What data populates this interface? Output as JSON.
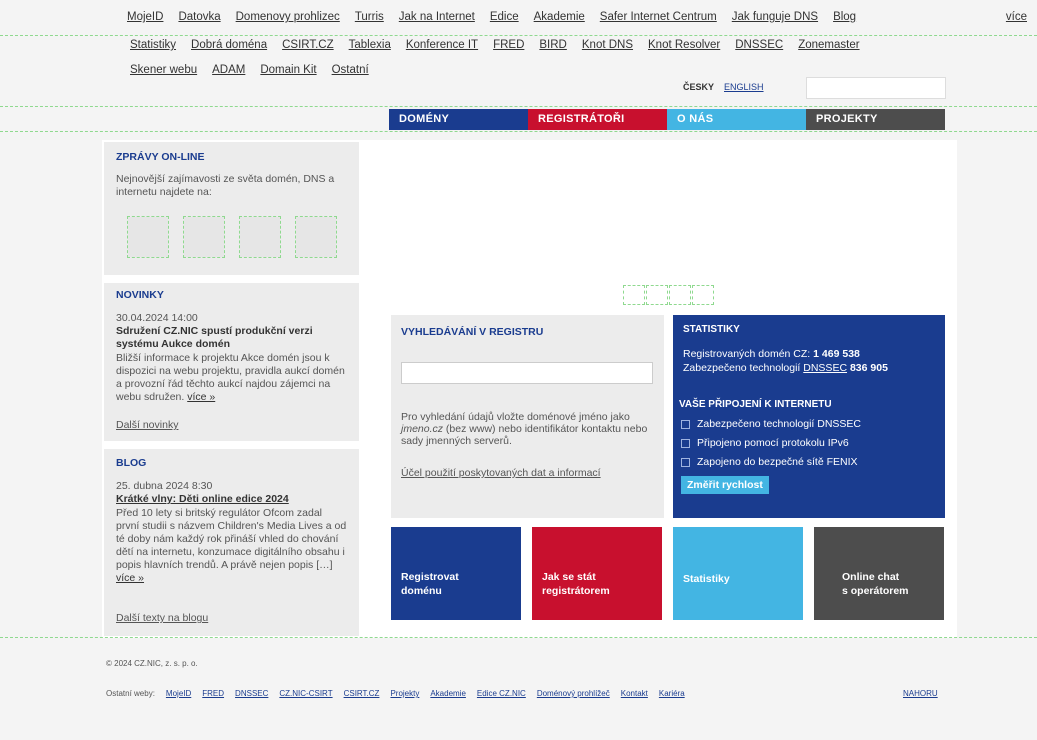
{
  "topnav": {
    "row1": [
      "MojeID",
      "Datovka",
      "Domenovy prohlizec",
      "Turris",
      "Jak na Internet",
      "Edice",
      "Akademie",
      "Safer Internet Centrum",
      "Jak funguje DNS",
      "Blog"
    ],
    "row2": [
      "Statistiky",
      "Dobrá doména",
      "CSIRT.CZ",
      "Tablexia",
      "Konference IT",
      "FRED",
      "BIRD",
      "Knot DNS",
      "Knot Resolver",
      "DNSSEC",
      "Zonemaster"
    ],
    "row3": [
      "Skener webu",
      "ADAM",
      "Domain Kit",
      "Ostatní"
    ],
    "more": "více"
  },
  "lang": {
    "cs": "ČESKY",
    "en": "ENGLISH"
  },
  "mainnav": [
    "DOMÉNY",
    "REGISTRÁTOŘI",
    "O NÁS",
    "PROJEKTY"
  ],
  "colors": {
    "blue": "#1a3c8f",
    "red": "#c8102e",
    "lightblue": "#43b5e3",
    "gray": "#4d4d4d"
  },
  "news_online": {
    "heading": "ZPRÁVY ON-LINE",
    "text": "Nejnovější zajímavosti ze světa domén, DNS a internetu najdete na:"
  },
  "novinky": {
    "heading": "NOVINKY",
    "date": "30.04.2024 14:00",
    "title": "Sdružení CZ.NIC spustí produkční verzi systému Aukce domén",
    "text": "Bližší informace k projektu Akce domén jsou k dispozici na webu projektu, pravidla aukcí domén a provozní řád těchto aukcí najdou zájemci na webu sdružen.",
    "more": "více »",
    "all": "Další novinky"
  },
  "blog": {
    "heading": "BLOG",
    "date": "25. dubna 2024 8:30",
    "title": "Krátké vlny: Děti online edice 2024",
    "text": "Před 10 lety si britský regulátor Ofcom zadal první studii s názvem Children's Media Lives a od té doby nám každý rok přináší vhled do chování dětí na internetu, konzumace digitálního obsahu i popis hlavních trendů. A právě nejen popis […]",
    "more": "více »",
    "all": "Další texty na blogu"
  },
  "registry": {
    "heading": "VYHLEDÁVÁNÍ V REGISTRU",
    "hint_a": "Pro vyhledání údajů vložte doménové jméno jako ",
    "hint_em": "jmeno.cz",
    "hint_b": " (bez www) nebo identifikátor kontaktu nebo sady jmenných serverů.",
    "terms": "Účel použití poskytovaných dat a informací"
  },
  "stats": {
    "heading": "STATISTIKY",
    "registered_label": "Registrovaných domén CZ:",
    "registered_value": "1 469 538",
    "secured_label": "Zabezpečeno technologií",
    "secured_link": "DNSSEC",
    "secured_value": "836 905",
    "conn_heading": "VAŠE PŘIPOJENÍ K INTERNETU",
    "checks": [
      "Zabezpečeno technologií DNSSEC",
      "Připojeno pomocí protokolu IPv6",
      "Zapojeno do bezpečné sítě FENIX"
    ],
    "button": "Změřit rychlost"
  },
  "tiles": [
    {
      "l1": "Registrovat",
      "l2": "doménu"
    },
    {
      "l1": "Jak se stát",
      "l2": "registrátorem"
    },
    {
      "l1": "Statistiky",
      "l2": ""
    },
    {
      "l1": "Online chat",
      "l2": "s operátorem"
    }
  ],
  "footer": {
    "copy": "© 2024 CZ.NIC, z. s. p. o.",
    "label": "Ostatní weby:",
    "links": [
      "MojeID",
      "FRED",
      "DNSSEC",
      "CZ.NIC-CSIRT",
      "CSIRT.CZ",
      "Projekty",
      "Akademie",
      "Edice CZ.NIC",
      "Doménový prohlížeč",
      "Kontakt",
      "Kariéra"
    ],
    "top": "NAHORU"
  }
}
